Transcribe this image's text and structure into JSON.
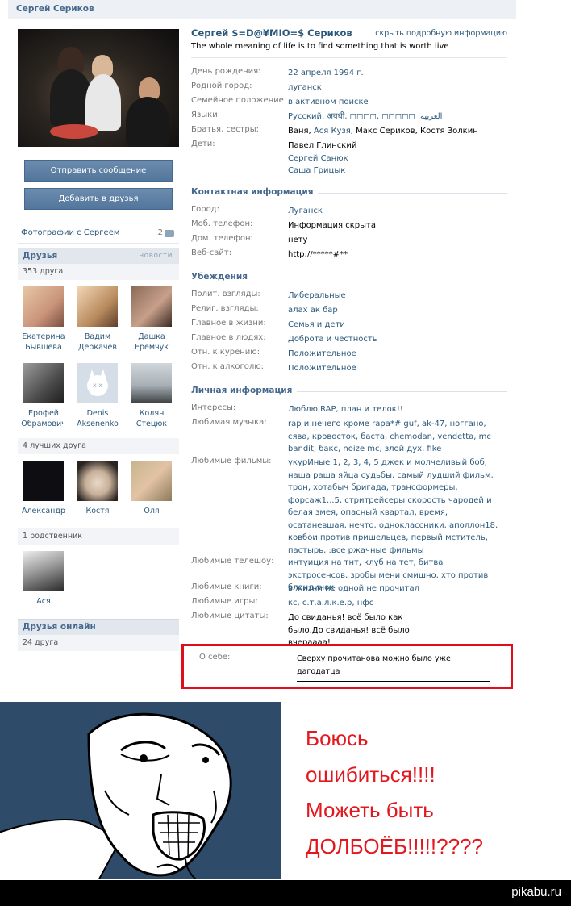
{
  "header": {
    "title": "Сергей Сериков"
  },
  "profile": {
    "name": "Сергей $=D@¥MIO=$ Сериков",
    "hide_link": "скрыть подробную информацию",
    "status": "The whole meaning of life is to find something that is worth live"
  },
  "actions": {
    "send_message": "Отправить сообщение",
    "add_friend": "Добавить в друзья"
  },
  "photos": {
    "label": "Фотографии с Сергеем",
    "count": "2"
  },
  "friends": {
    "title": "Друзья",
    "news": "новости",
    "count": "353 друга",
    "items": [
      {
        "first": "Екатерина",
        "last": "Бывшева"
      },
      {
        "first": "Вадим",
        "last": "Деркачев"
      },
      {
        "first": "Дашка",
        "last": "Еремчук"
      },
      {
        "first": "Ерофей",
        "last": "Обрамович"
      },
      {
        "first": "Denis",
        "last": "Aksenenko"
      },
      {
        "first": "Колян",
        "last": "Стецюк"
      }
    ],
    "best_count": "4 лучших друга",
    "best": [
      {
        "name": "Александр"
      },
      {
        "name": "Костя"
      },
      {
        "name": "Оля"
      }
    ],
    "relatives_count": "1 родственник",
    "relatives": [
      {
        "name": "Ася"
      }
    ],
    "online_title": "Друзья онлайн",
    "online_count": "24 друга"
  },
  "info": {
    "birthday": {
      "label": "День рождения:",
      "value": "22 апреля 1994 г."
    },
    "hometown": {
      "label": "Родной город:",
      "value": "луганск"
    },
    "family": {
      "label": "Семейное положение:",
      "value": "в активном поиске"
    },
    "languages": {
      "label": "Языки:",
      "value": "Русский, अवधी, ◻◻◻◻, ◻◻◻◻◻ ,العربية"
    },
    "siblings": {
      "label": "Братья, сестры:",
      "v1": "Ваня, ",
      "v2": "Ася Кузя",
      "v3": ", Макс Сериков, Костя Золкин"
    },
    "children": {
      "label": "Дети:",
      "c1": "Павел Глинский",
      "c2": "Сергей Санюк",
      "c3": "Саша Грицык"
    }
  },
  "contacts": {
    "title": "Контактная информация",
    "city": {
      "label": "Город:",
      "value": "Луганск"
    },
    "mobile": {
      "label": "Моб. телефон:",
      "value": "Информация скрыта"
    },
    "home": {
      "label": "Дом. телефон:",
      "value": "нету"
    },
    "site": {
      "label": "Веб-сайт:",
      "value": "http://*****#**"
    }
  },
  "beliefs": {
    "title": "Убеждения",
    "political": {
      "label": "Полит. взгляды:",
      "value": "Либеральные"
    },
    "religion": {
      "label": "Религ. взгляды:",
      "value": "алах ак бар"
    },
    "life": {
      "label": "Главное в жизни:",
      "value": "Семья и дети"
    },
    "people": {
      "label": "Главное в людях:",
      "value": "Доброта и честность"
    },
    "smoking": {
      "label": "Отн. к курению:",
      "value": "Положительное"
    },
    "alcohol": {
      "label": "Отн. к алкоголю:",
      "value": "Положительное"
    }
  },
  "personal": {
    "title": "Личная информация",
    "interests": {
      "label": "Интересы:",
      "value": "Люблю RAP, план и телок!!"
    },
    "music": {
      "label": "Любимая музыка:",
      "value": "rap и нечего кроме rapa*# guf, ak-47, ноггано, сява, кровосток, баста, chemodan, vendetta, mc bandit, бакс, noize mc, злой дух, fike"
    },
    "films": {
      "label": "Любимые фильмы:",
      "value": "укурИные 1, 2, 3, 4, 5 джек и молчеливый боб, наша раша яйца судьбы, самый лудший фильм, трон, хотабыч бригада, трансформеры, форсаж1...5, стритрейсеры скорость чародей и белая змея, опасный квартал, время, осатаневшая, нечто, одноклассники, аполлон18, ковбои против пришельцев, первый мститель, пастырь, :все ржачные фильмы"
    },
    "tv": {
      "label": "Любимые телешоу:",
      "value": "интуиция на тнт, клуб на тет, битва экстросенсов, зробы мени смишно, хто против блондинок"
    },
    "books": {
      "label": "Любимые книги:",
      "value": "в жизни не одной не прочитал"
    },
    "games": {
      "label": "Любимые игры:",
      "value": "кс, с.т.а.л.к.е.р, нфс"
    },
    "quotes": {
      "label": "Любимые цитаты:",
      "value": "До свиданья! всё было как было.До свиданья! всё было вчераааа!"
    },
    "about": {
      "label": "О себе:",
      "value": "Сверху прочитанова можно было уже дагодатца"
    }
  },
  "meme": {
    "caption": [
      "Боюсь",
      "ошибиться!!!!",
      "Можеть быть",
      "ДОЛБОЁБ!!!!!????"
    ]
  },
  "footer": {
    "site": "pikabu.ru"
  },
  "colors": {
    "vk_blue": "#45688e",
    "link": "#2b587a",
    "highlight": "#e00d1a",
    "meme_bg": "#2e4c6a"
  }
}
